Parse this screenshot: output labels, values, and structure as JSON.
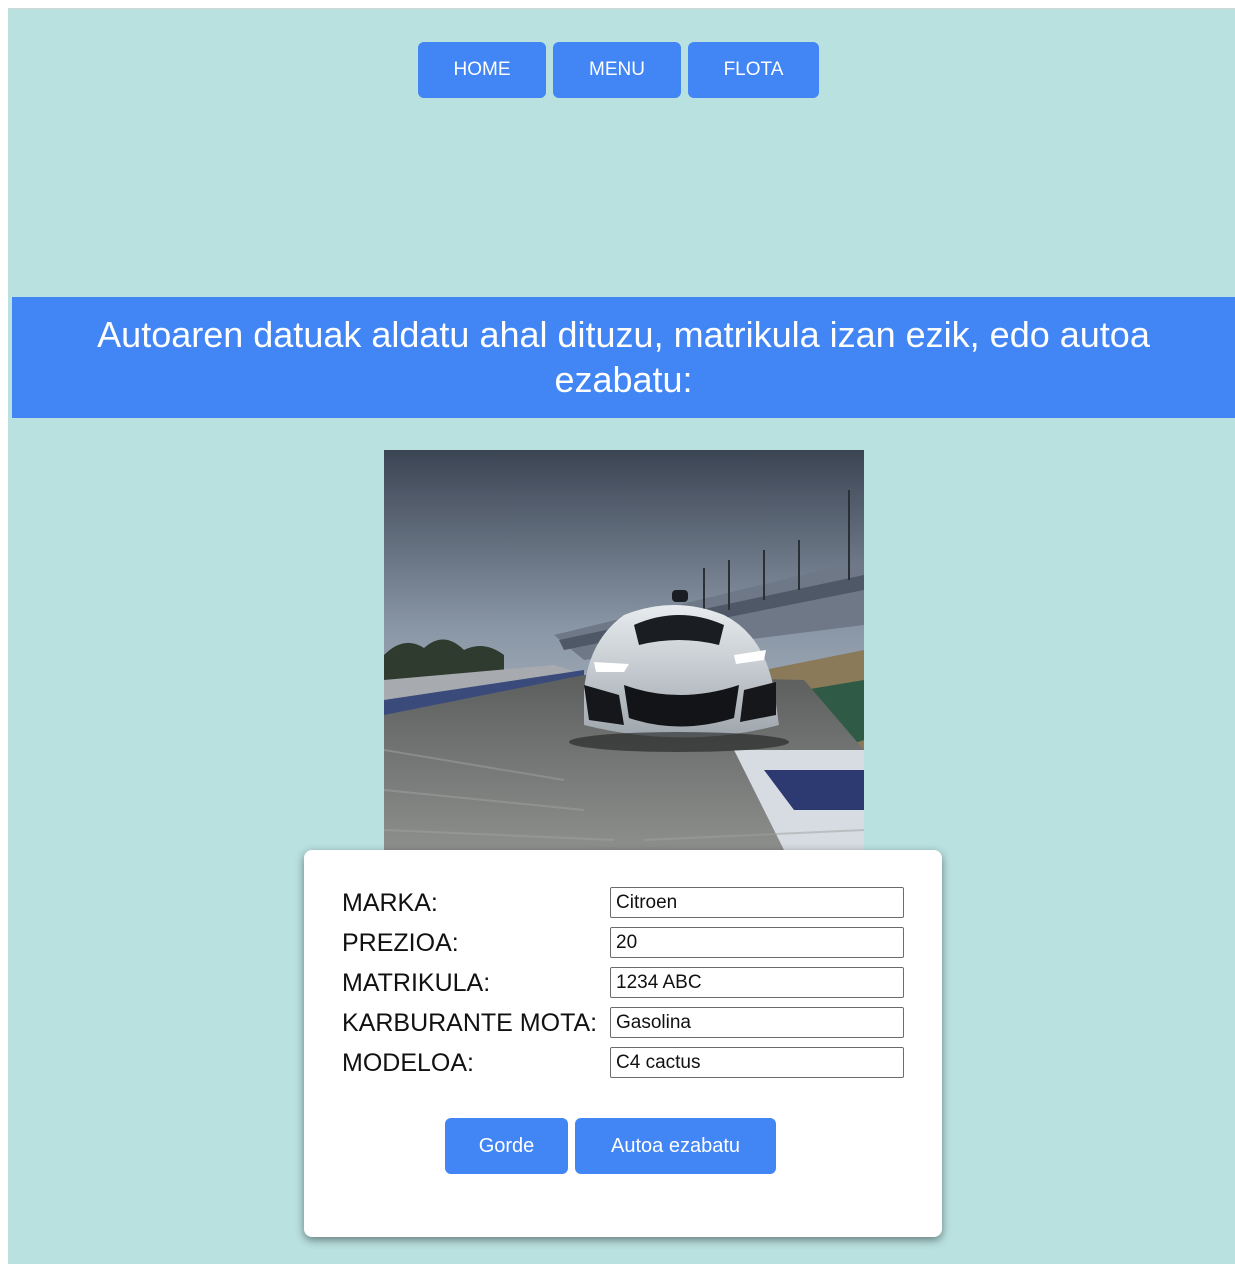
{
  "nav": {
    "items": [
      {
        "label": "HOME"
      },
      {
        "label": "MENU"
      },
      {
        "label": "FLOTA"
      }
    ]
  },
  "banner": {
    "text": "Autoaren datuak aldatu ahal dituzu, matrikula izan ezik, edo autoa ezabatu:"
  },
  "car_image": {
    "subject": "silver hypercar on race track"
  },
  "form": {
    "fields": [
      {
        "label": "MARKA:",
        "value": "Citroen"
      },
      {
        "label": "PREZIOA:",
        "value": "20"
      },
      {
        "label": "MATRIKULA:",
        "value": "1234 ABC"
      },
      {
        "label": "KARBURANTE MOTA:",
        "value": "Gasolina"
      },
      {
        "label": "MODELOA:",
        "value": "C4 cactus"
      }
    ],
    "save_label": "Gorde",
    "delete_label": "Autoa ezabatu"
  },
  "colors": {
    "background": "#b9e1e0",
    "accent": "#4285f4",
    "card": "#ffffff"
  }
}
